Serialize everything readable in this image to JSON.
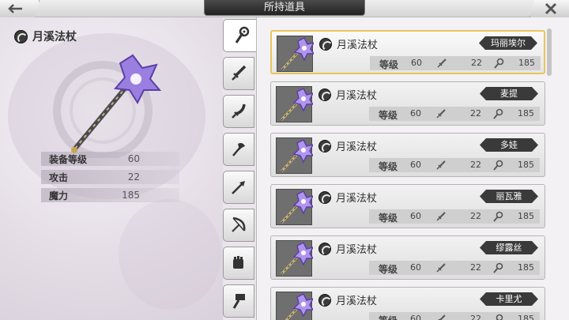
{
  "header": {
    "title": "所持道具"
  },
  "detail": {
    "name": "月溪法杖",
    "stats": [
      {
        "label": "装备等级",
        "value": "60"
      },
      {
        "label": "攻击",
        "value": "22"
      },
      {
        "label": "魔力",
        "value": "185"
      }
    ]
  },
  "tabs": [
    {
      "name": "tab-staff",
      "icon": "staff-icon",
      "active": true
    },
    {
      "name": "tab-sword",
      "icon": "sword-icon"
    },
    {
      "name": "tab-blade",
      "icon": "curved-blade-icon"
    },
    {
      "name": "tab-axe",
      "icon": "axe-icon"
    },
    {
      "name": "tab-spear",
      "icon": "spear-icon"
    },
    {
      "name": "tab-bow",
      "icon": "bow-icon"
    },
    {
      "name": "tab-gauntlet",
      "icon": "gauntlet-icon"
    },
    {
      "name": "tab-hammer",
      "icon": "hammer-icon"
    }
  ],
  "items": [
    {
      "name": "月溪法杖",
      "owner": "玛丽埃尔",
      "level_label": "等级",
      "level": "60",
      "attack": "22",
      "magic": "185"
    },
    {
      "name": "月溪法杖",
      "owner": "麦提",
      "level_label": "等级",
      "level": "60",
      "attack": "22",
      "magic": "185"
    },
    {
      "name": "月溪法杖",
      "owner": "多娃",
      "level_label": "等级",
      "level": "60",
      "attack": "22",
      "magic": "185"
    },
    {
      "name": "月溪法杖",
      "owner": "丽瓦雅",
      "level_label": "等级",
      "level": "60",
      "attack": "22",
      "magic": "185"
    },
    {
      "name": "月溪法杖",
      "owner": "缪露丝",
      "level_label": "等级",
      "level": "60",
      "attack": "22",
      "magic": "185"
    },
    {
      "name": "月溪法杖",
      "owner": "卡里尤",
      "level_label": "等级",
      "level": "60",
      "attack": "22",
      "magic": "185"
    }
  ],
  "colors": {
    "selected_border": "#e6c65e",
    "owner_plate": "#3a3a3a",
    "title_plate": "#2a2a2a"
  }
}
